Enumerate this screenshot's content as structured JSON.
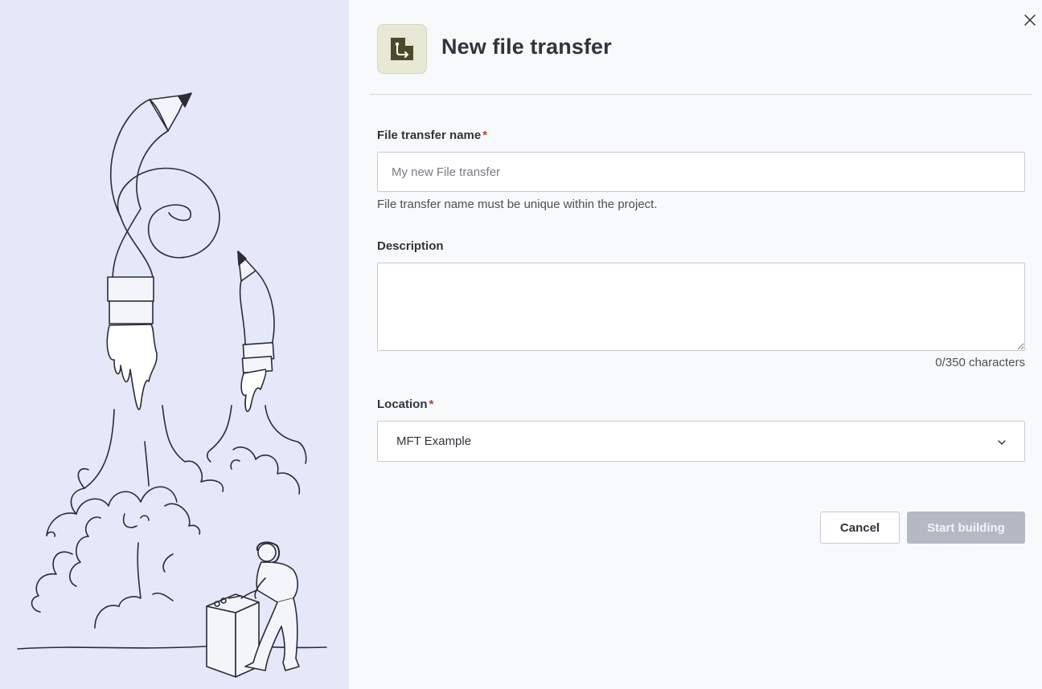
{
  "dialog": {
    "title": "New file transfer",
    "header_icon": "file-transfer-icon",
    "close_icon": "close-icon"
  },
  "form": {
    "name_field": {
      "label": "File transfer name",
      "required_marker": "*",
      "placeholder": "My new File transfer",
      "value": "",
      "helper": "File transfer name must be unique within the project."
    },
    "description_field": {
      "label": "Description",
      "value": "",
      "char_count": "0/350 characters"
    },
    "location_field": {
      "label": "Location",
      "required_marker": "*",
      "selected": "MFT Example",
      "icon": "chevron-down-icon"
    }
  },
  "actions": {
    "cancel_label": "Cancel",
    "primary_label": "Start building"
  },
  "colors": {
    "illustration_bg": "#e4e8f8",
    "panel_bg": "#f8f9fb",
    "icon_box_bg": "#e7e8d5",
    "icon_fg": "#4b4a2c",
    "required": "#c0392b",
    "disabled_button": "#b4b9c4"
  }
}
